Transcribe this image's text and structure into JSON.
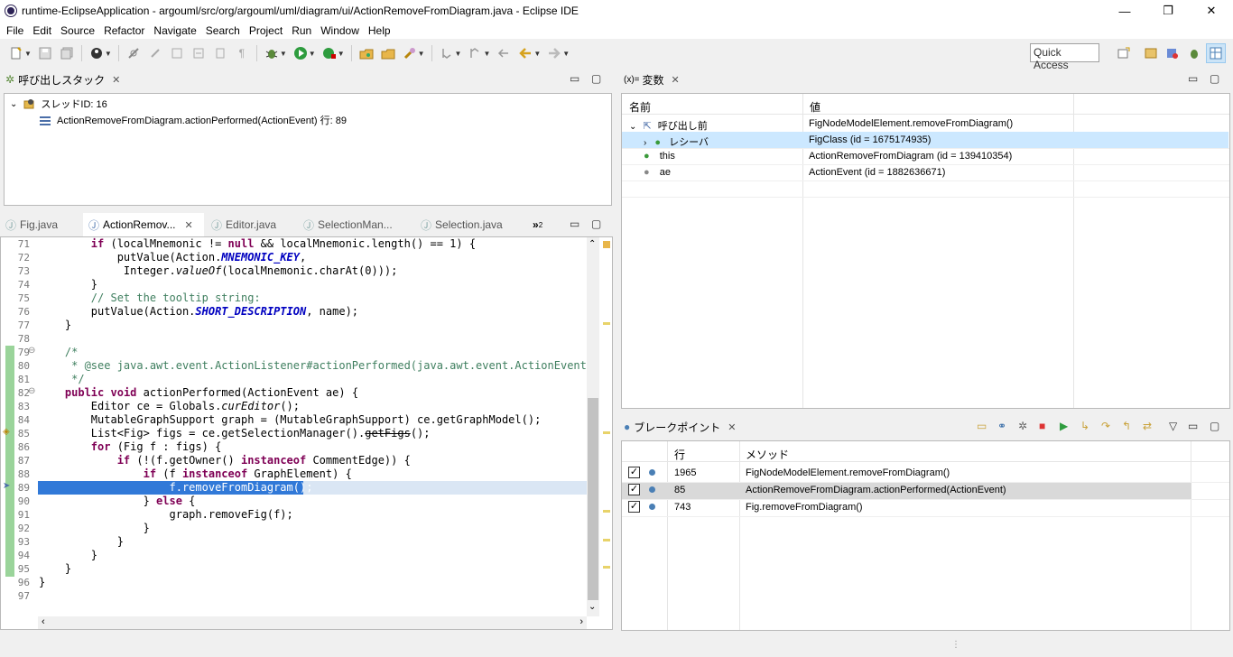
{
  "window": {
    "title": "runtime-EclipseApplication - argouml/src/org/argouml/uml/diagram/ui/ActionRemoveFromDiagram.java - Eclipse IDE",
    "minimize": "—",
    "restore": "❐",
    "close": "✕"
  },
  "menu": [
    "File",
    "Edit",
    "Source",
    "Refactor",
    "Navigate",
    "Search",
    "Project",
    "Run",
    "Window",
    "Help"
  ],
  "toolbar": {
    "quick_access": "Quick Access",
    "icons": [
      "new-icon",
      "save-icon",
      "save-all-icon",
      "debug-icon",
      "run-icon",
      "external-tools-icon",
      "open-type-icon",
      "search-icon",
      "back-icon",
      "forward-icon"
    ]
  },
  "callstack": {
    "tab_label": "呼び出しスタック",
    "thread": "スレッドID: 16",
    "frame": "ActionRemoveFromDiagram.actionPerformed(ActionEvent) 行: 89"
  },
  "editor": {
    "tabs": [
      {
        "label": "Fig.java",
        "active": false
      },
      {
        "label": "ActionRemov...",
        "active": true
      },
      {
        "label": "Editor.java",
        "active": false
      },
      {
        "label": "SelectionMan...",
        "active": false
      },
      {
        "label": "Selection.java",
        "active": false
      }
    ],
    "overflow": "»",
    "overflow_count": "2",
    "current_line": "89"
  },
  "variables": {
    "tab_label": "変数",
    "tab_prefix": "(x)=",
    "col_name": "名前",
    "col_value": "値",
    "rows": [
      {
        "name": "呼び出し前",
        "value": "FigNodeModelElement.removeFromDiagram()"
      },
      {
        "name": "レシーバ",
        "value": "FigClass (id = 1675174935)"
      },
      {
        "name": "this",
        "value": "ActionRemoveFromDiagram (id = 139410354)"
      },
      {
        "name": "ae",
        "value": "ActionEvent (id = 1882636671)"
      }
    ]
  },
  "breakpoints": {
    "tab_label": "ブレークポイント",
    "col_line": "行",
    "col_method": "メソッド",
    "rows": [
      {
        "line": "1965",
        "method": "FigNodeModelElement.removeFromDiagram()",
        "checked": true
      },
      {
        "line": "85",
        "method": "ActionRemoveFromDiagram.actionPerformed(ActionEvent)",
        "checked": true
      },
      {
        "line": "743",
        "method": "Fig.removeFromDiagram()",
        "checked": true
      }
    ]
  },
  "colors": {
    "keyword": "#7f0055",
    "comment": "#3f7f5f",
    "field": "#0000c0",
    "selection": "#3179d8",
    "breakpoint_dot": "#4a7fb5"
  }
}
